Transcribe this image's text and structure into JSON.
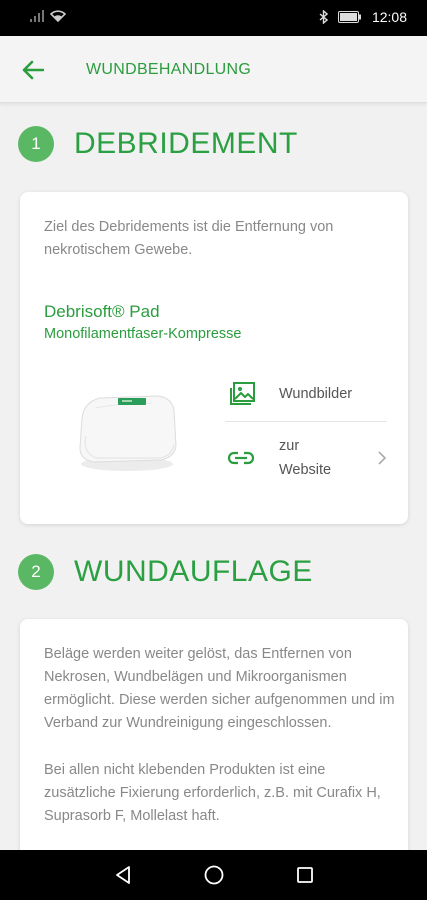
{
  "status_bar": {
    "time": "12:08"
  },
  "header": {
    "title": "WUNDBEHANDLUNG"
  },
  "sections": [
    {
      "number": "1",
      "title": "DEBRIDEMENT",
      "description": "Ziel des Debridements ist die Entfernung von nekrotischem Gewebe.",
      "product_name": "Debrisoft® Pad",
      "product_subtitle": "Monofilamentfaser-Kompresse",
      "links": [
        {
          "icon": "image-icon",
          "label": "Wundbilder"
        },
        {
          "icon": "link-icon",
          "label_line1": "zur",
          "label_line2": "Website"
        }
      ]
    },
    {
      "number": "2",
      "title": "WUNDAUFLAGE",
      "description_p1": "Beläge werden weiter gelöst, das Entfernen von Nekrosen, Wundbelägen und Mikroorganismen ermöglicht. Diese werden sicher aufgenommen und im Verband zur Wundreinigung eingeschlossen.",
      "description_p2": "Bei allen nicht klebenden Produkten ist eine zusätzliche Fixierung erforderlich, z.B. mit Curafix H, Suprasorb F, Mollelast haft."
    }
  ],
  "colors": {
    "accent": "#2a9d3e",
    "step_circle": "#5ab864",
    "background": "#f1f1f1"
  }
}
